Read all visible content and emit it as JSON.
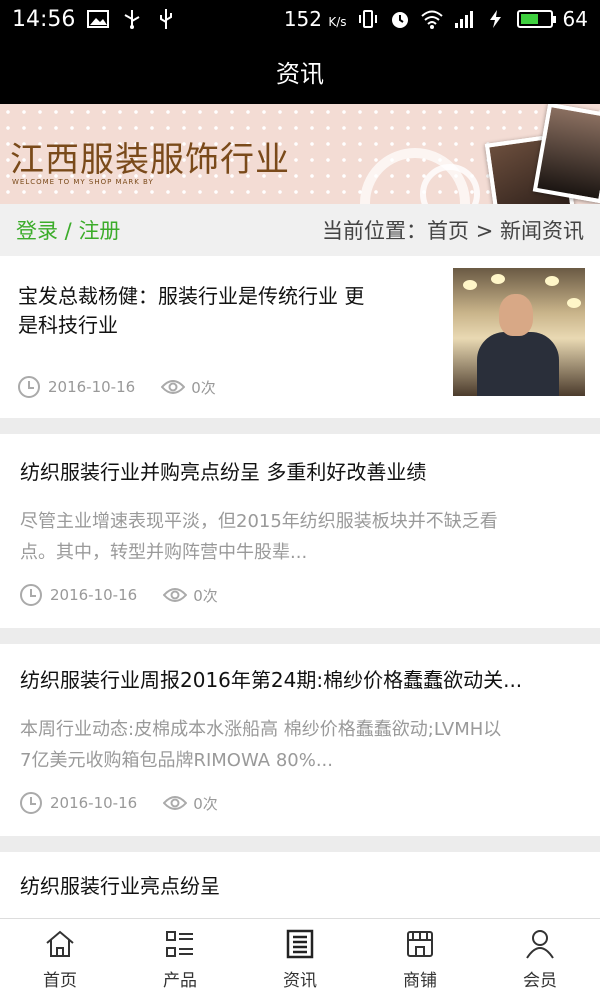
{
  "status_bar": {
    "time": "14:56",
    "speed": "152",
    "speed_unit": "K/s",
    "battery": "64",
    "battery_level": 0.64,
    "icons": [
      "image-icon",
      "usb-icon",
      "vibrate-icon",
      "alarm-icon",
      "wifi-icon",
      "signal-icon",
      "charging-icon"
    ]
  },
  "header": {
    "title": "资讯"
  },
  "banner": {
    "title": "江西服装服饰行业",
    "subtitle": "WELCOME TO MY SHOP MARK BY"
  },
  "location_bar": {
    "login": "登录",
    "separator": " / ",
    "register": "注册",
    "breadcrumb_prefix": "当前位置：",
    "breadcrumb_home": "首页",
    "breadcrumb_arrow": " > ",
    "breadcrumb_current": "新闻资讯"
  },
  "articles": [
    {
      "title_line1": "宝发总裁杨健：服装行业是传统行业 更",
      "title_line2": "是科技行业",
      "date": "2016-10-16",
      "views": "0次"
    },
    {
      "title": "纺织服装行业并购亮点纷呈 多重利好改善业绩",
      "summary_line1": "尽管主业增速表现平淡，但2015年纺织服装板块并不缺乏看",
      "summary_line2": "点。其中，转型并购阵营中牛股辈...",
      "date": "2016-10-16",
      "views": "0次"
    },
    {
      "title": "纺织服装行业周报2016年第24期:棉纱价格蠢蠢欲动关...",
      "summary_line1": "本周行业动态:皮棉成本水涨船高 棉纱价格蠢蠢欲动;LVMH以",
      "summary_line2": "7亿美元收购箱包品牌RIMOWA 80%...",
      "date": "2016-10-16",
      "views": "0次"
    },
    {
      "title": "纺织服装行业亮点纷呈"
    }
  ],
  "bottom_nav": [
    {
      "label": "首页",
      "icon": "home-icon"
    },
    {
      "label": "产品",
      "icon": "list-icon"
    },
    {
      "label": "资讯",
      "icon": "news-icon",
      "active": true
    },
    {
      "label": "商铺",
      "icon": "shop-icon"
    },
    {
      "label": "会员",
      "icon": "user-icon"
    }
  ],
  "colors": {
    "accent_green": "#3cac2a",
    "header_bg": "#000000"
  }
}
